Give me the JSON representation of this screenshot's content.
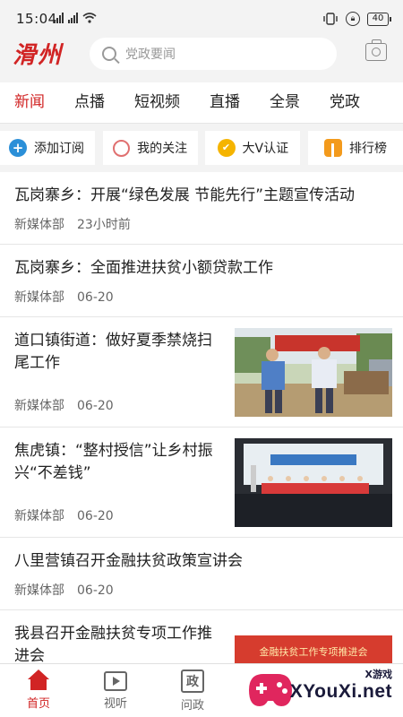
{
  "status": {
    "time": "15:04",
    "battery": "40"
  },
  "header": {
    "logo": "滑州",
    "search_placeholder": "党政要闻"
  },
  "tabs": [
    "新闻",
    "点播",
    "短视频",
    "直播",
    "全景",
    "党政"
  ],
  "quick_actions": [
    {
      "label": "添加订阅",
      "icon": "plus-circle-icon"
    },
    {
      "label": "我的关注",
      "icon": "heart-circle-icon"
    },
    {
      "label": "大V认证",
      "icon": "v-badge-icon"
    },
    {
      "label": "排行榜",
      "icon": "ranking-icon"
    }
  ],
  "news": [
    {
      "title": "瓦岗寨乡：开展“绿色发展 节能先行”主题宣传活动",
      "source": "新媒体部",
      "time": "23小时前"
    },
    {
      "title": "瓦岗寨乡：全面推进扶贫小额贷款工作",
      "source": "新媒体部",
      "time": "06-20"
    },
    {
      "title": "道口镇街道：做好夏季禁烧扫尾工作",
      "source": "新媒体部",
      "time": "06-20"
    },
    {
      "title": "焦虎镇：“整村授信”让乡村振兴“不差钱”",
      "source": "新媒体部",
      "time": "06-20"
    },
    {
      "title": "八里营镇召开金融扶贫政策宣讲会",
      "source": "新媒体部",
      "time": "06-20"
    },
    {
      "title": "我县召开金融扶贫专项工作推进会",
      "source": "",
      "time": ""
    }
  ],
  "thumb_captions": {
    "meeting_banner": "金融扶贫工作专项推进会"
  },
  "tabbar": [
    {
      "label": "首页",
      "icon": "home-icon",
      "active": true
    },
    {
      "label": "视听",
      "icon": "tv-icon"
    },
    {
      "label": "问政",
      "icon": "zheng-icon",
      "glyph": "政"
    }
  ],
  "watermark": {
    "brand": "XYouXi.net",
    "small": "X游戏"
  },
  "colors": {
    "accent": "#d12424",
    "background": "#f3f3f3"
  }
}
